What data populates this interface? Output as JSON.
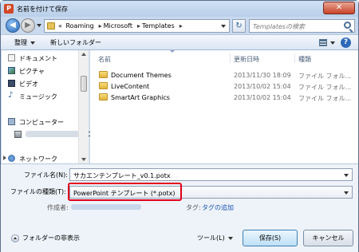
{
  "window": {
    "title": "名前を付けて保存",
    "app_icon": "P",
    "close_glyph": "✕"
  },
  "address": {
    "crumbs": [
      "«",
      "Roaming",
      "Microsoft",
      "Templates"
    ],
    "separator": "▸",
    "search_placeholder": "Templatesの検索"
  },
  "toolbar": {
    "organize": "整理",
    "new_folder": "新しいフォルダー",
    "help": "?"
  },
  "nav": {
    "items": [
      "ドキュメント",
      "ピクチャ",
      "ビデオ",
      "ミュージック"
    ],
    "computer": "コンピューター",
    "drive_suffix": "(C",
    "network": "ネットワーク"
  },
  "filelist": {
    "headers": {
      "name": "名前",
      "date": "更新日時",
      "type": "種類"
    },
    "rows": [
      {
        "name": "Document Themes",
        "date": "2013/11/30 18:09",
        "type": "ファイル フォル..."
      },
      {
        "name": "LiveContent",
        "date": "2013/10/02 15:04",
        "type": "ファイル フォル..."
      },
      {
        "name": "SmartArt Graphics",
        "date": "2013/10/02 15:04",
        "type": "ファイル フォル..."
      }
    ]
  },
  "form": {
    "filename_label": "ファイル名(N):",
    "filename_value": "サカエンテンプレート_v0.1.potx",
    "filetype_label": "ファイルの種類(T):",
    "filetype_value": "PowerPoint テンプレート (*.potx)",
    "author_label": "作成者:",
    "tags_label": "タグ:",
    "tags_link": "タグの追加",
    "hide_folders": "フォルダーの非表示",
    "tools": "ツール(L)",
    "save": "保存(S)",
    "cancel": "キャンセル"
  },
  "colors": {
    "highlight": "#e0001a",
    "frame": "#c9daef"
  }
}
